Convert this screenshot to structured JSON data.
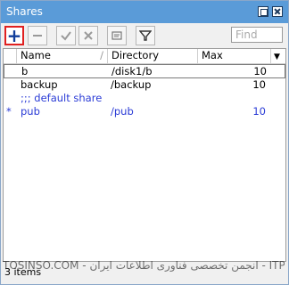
{
  "window": {
    "title": "Shares"
  },
  "toolbar": {
    "search_placeholder": "Find"
  },
  "table": {
    "columns": [
      "Name",
      "Directory",
      "Max Sessions"
    ],
    "rows": [
      {
        "flag": "",
        "name": "b",
        "directory": "/disk1/b",
        "sessions": "10"
      },
      {
        "flag": "",
        "name": "backup",
        "directory": "/backup",
        "sessions": "10"
      },
      {
        "comment": ";;; default share"
      },
      {
        "flag": "*",
        "name": "pub",
        "directory": "/pub",
        "sessions": "10"
      }
    ]
  },
  "status": {
    "items": "3 items"
  },
  "watermark": "TOSINSO.COM - انجمن تخصصی فناوری اطلاعات ایران - ITPro.ir"
}
